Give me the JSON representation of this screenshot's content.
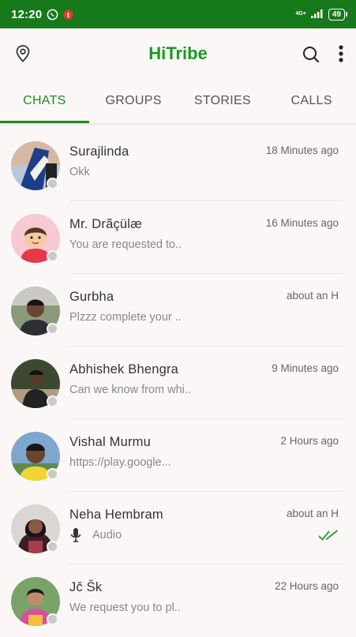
{
  "status_bar": {
    "time": "12:20",
    "network": "4G+",
    "battery": "49"
  },
  "app": {
    "title": "HiTribe",
    "accent": "#16791a"
  },
  "tabs": [
    {
      "label": "CHATS",
      "active": true
    },
    {
      "label": "GROUPS",
      "active": false
    },
    {
      "label": "STORIES",
      "active": false
    },
    {
      "label": "CALLS",
      "active": false
    }
  ],
  "chats": [
    {
      "name": "Surajlinda",
      "time": "18 Minutes ago",
      "message": "Okk"
    },
    {
      "name": "Mr. Drãçülæ",
      "time": "16 Minutes ago",
      "message": "You are requested to.."
    },
    {
      "name": "Gurbha",
      "time": "about an H",
      "message": "Plzzz complete your .."
    },
    {
      "name": "Abhishek Bhengra",
      "time": "9 Minutes ago",
      "message": "Can we know from whi.."
    },
    {
      "name": "Vishal Murmu",
      "time": "2 Hours ago",
      "message": "https://play.google..."
    },
    {
      "name": "Neha Hembram",
      "time": "about an H",
      "message": "Audio"
    },
    {
      "name": "Jč Šk",
      "time": "22 Hours ago",
      "message": "We request you to pl.."
    }
  ]
}
